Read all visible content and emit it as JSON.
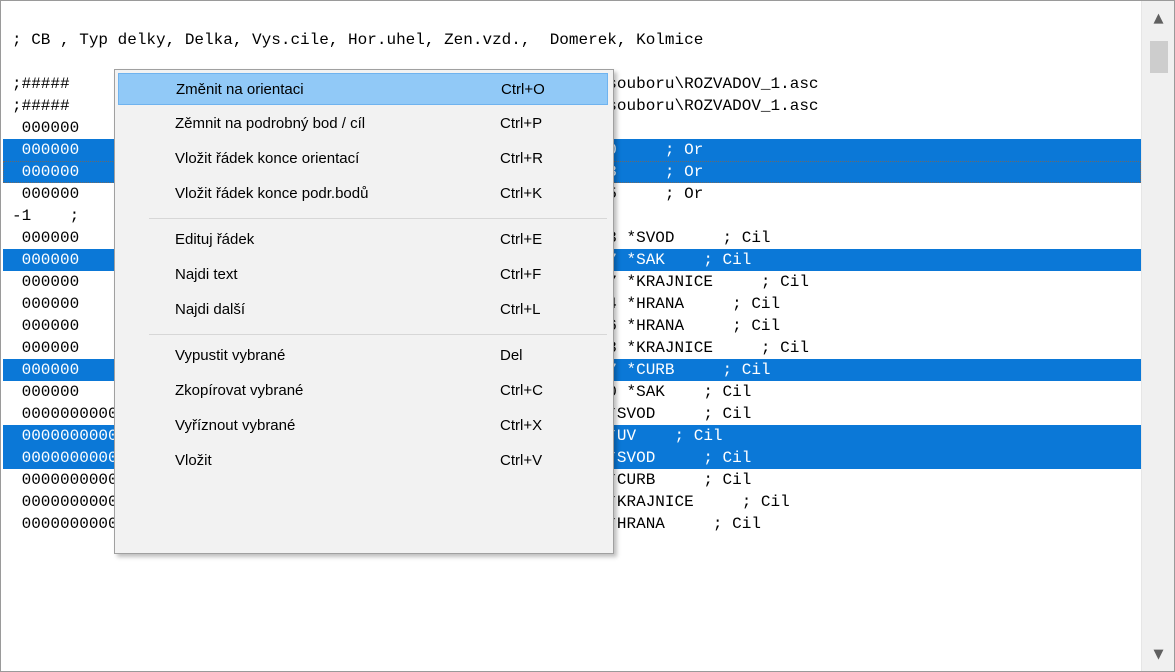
{
  "editor": {
    "lines": [
      {
        "text": ""
      },
      {
        "text": "; CB , Typ delky, Delka, Vys.cile, Hor.uhel, Zen.vzd.,  Domerek, Kolmice"
      },
      {
        "text": ""
      },
      {
        "text": ";#####                                          konverze_vice_souboru\\ROZVADOV_1.asc"
      },
      {
        "text": ";#####                                          konverze_vice_souboru\\ROZVADOV_1.asc"
      },
      {
        "text": " 000000                                         NOVISKO"
      },
      {
        "text": " 000000                                         .8861   99.4020     ; Or"
      },
      {
        "text": " 000000                                         .6070  101.7733     ; Or"
      },
      {
        "text": " 000000                                         .2108  100.7285     ; Or"
      },
      {
        "text": "-1    ;"
      },
      {
        "text": " 000000                                         .9273   99.3263 *SVOD     ; Cil"
      },
      {
        "text": " 000000                                         .0923   99.2587 *SAK    ; Cil"
      },
      {
        "text": " 000000                                         .0272   99.1097 *KRAJNICE     ; Cil"
      },
      {
        "text": " 000000                                         .4551   99.2104 *HRANA     ; Cil"
      },
      {
        "text": " 000000                                         .0152   99.3136 *HRANA     ; Cil"
      },
      {
        "text": " 000000                                         .7459   99.1498 *KRAJNICE     ; Cil"
      },
      {
        "text": " 000000                                         .3818   99.3187 *CURB     ; Cil"
      },
      {
        "text": " 000000                                         .8548   99.3050 *SAK    ; Cil"
      },
      {
        "text": " 000000000000009 2      114.435    1.570   258.2064   99.3486 *SVOD     ; Cil"
      },
      {
        "text": " 000000000000010 2      117.506    1.570   257.1504   99.3804 *UV    ; Cil"
      },
      {
        "text": " 000000000000011 2      104.449    1.570   258.6238   99.4456 *SVOD     ; Cil"
      },
      {
        "text": " 000000000000012 2      103.957    1.570   257.7457   99.3781 *CURB     ; Cil"
      },
      {
        "text": " 000000000000013 2      103.779    1.570   250.4481   99.2023 *KRAJNICE     ; Cil"
      },
      {
        "text": " 000000000000014 2      102.607    1.570   249.7467   99.2690 *HRANA     ; Cil"
      }
    ],
    "selected_line_indices": [
      6,
      7,
      11,
      16,
      19,
      20
    ],
    "focused_line_index": 7
  },
  "context_menu": {
    "items": [
      {
        "label": "Změnit na orientaci",
        "shortcut": "Ctrl+O",
        "highlighted": true
      },
      {
        "label": "Zěmnit na podrobný bod / cíl",
        "shortcut": "Ctrl+P"
      },
      {
        "label": "Vložit řádek konce orientací",
        "shortcut": "Ctrl+R"
      },
      {
        "label": "Vložit řádek konce podr.bodů",
        "shortcut": "Ctrl+K"
      },
      {
        "separator": true
      },
      {
        "label": "Edituj řádek",
        "shortcut": "Ctrl+E"
      },
      {
        "label": "Najdi text",
        "shortcut": "Ctrl+F"
      },
      {
        "label": "Najdi další",
        "shortcut": "Ctrl+L"
      },
      {
        "separator": true
      },
      {
        "label": "Vypustit vybrané",
        "shortcut": "Del"
      },
      {
        "label": "Zkopírovat vybrané",
        "shortcut": "Ctrl+C"
      },
      {
        "label": "Vyříznout vybrané",
        "shortcut": "Ctrl+X"
      },
      {
        "label": "Vložit",
        "shortcut": "Ctrl+V"
      }
    ]
  },
  "scrollbar": {
    "up_icon": "▲",
    "down_icon": "▼"
  },
  "colors": {
    "selection": "#0b78d7",
    "menu_highlight": "#91c9f7",
    "menu_background": "#f2f2f2"
  }
}
